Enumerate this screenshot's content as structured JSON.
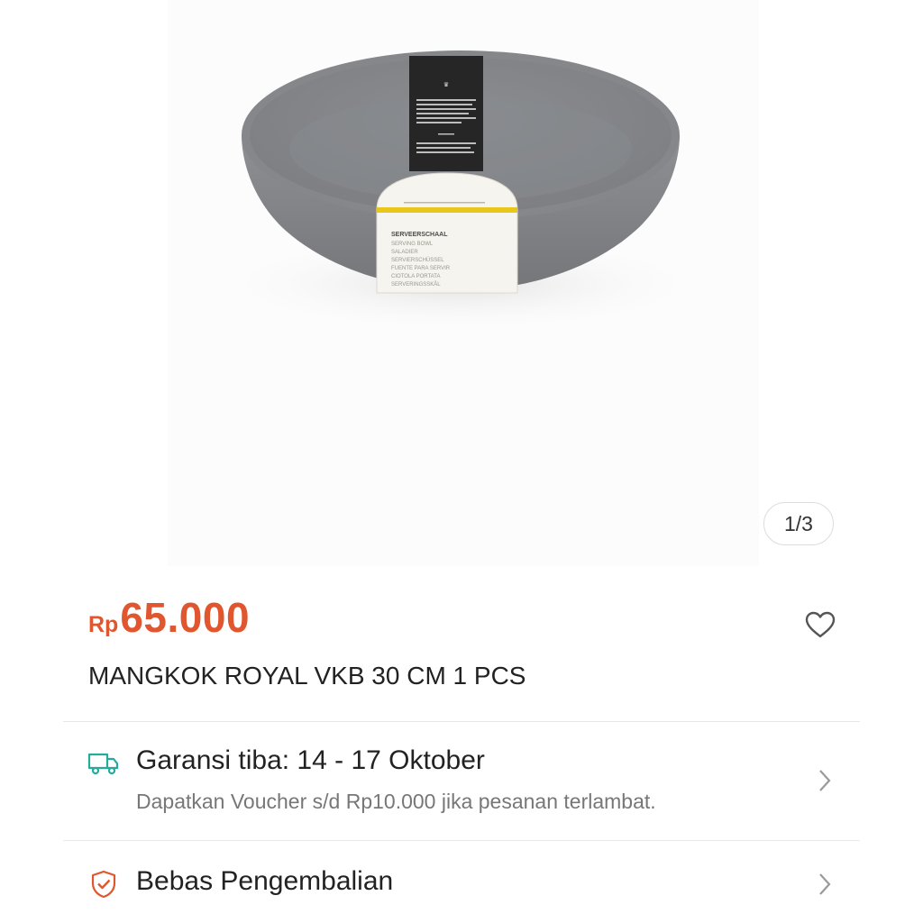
{
  "gallery": {
    "counter": "1/3",
    "product_label": {
      "name": "SERVEERSCHAAL",
      "lines": [
        "SERVING BOWL",
        "SALADIER",
        "SERVIERSCHÜSSEL",
        "FUENTE PARA SERVIR",
        "CIOTOLA PORTATA",
        "SERVERINGSSKÅL"
      ]
    }
  },
  "product": {
    "currency": "Rp",
    "price": "65.000",
    "title": "MANGKOK ROYAL VKB 30 CM 1 PCS"
  },
  "shipping": {
    "title": "Garansi tiba: 14 - 17 Oktober",
    "subtitle": "Dapatkan Voucher s/d Rp10.000 jika pesanan terlambat."
  },
  "returns": {
    "title": "Bebas Pengembalian"
  },
  "colors": {
    "price": "#e0562f",
    "shipping_icon": "#26aa99",
    "returns_icon": "#e0562f"
  }
}
